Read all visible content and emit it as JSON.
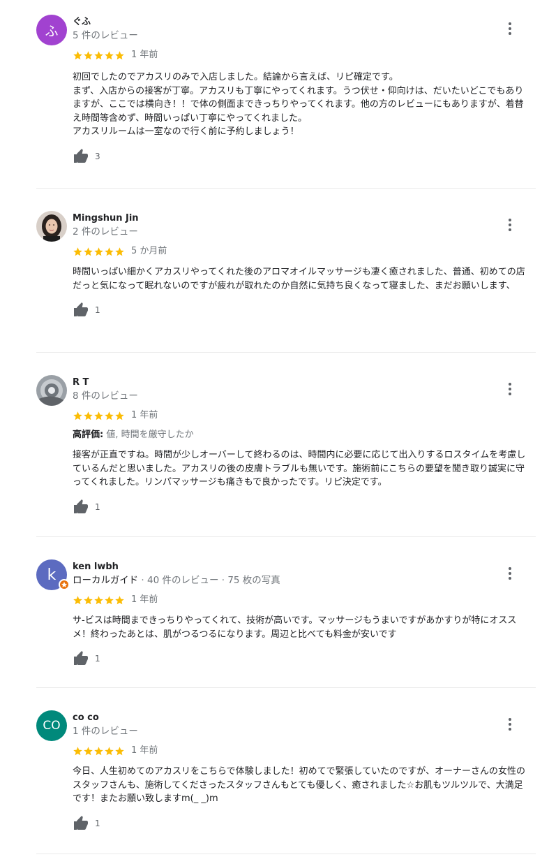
{
  "colors": {
    "star": "#fbbc04",
    "meta_text": "#70757a",
    "icon": "#5f6368",
    "divider": "#ebebeb"
  },
  "reviews": [
    {
      "name": "ぐふ",
      "avatar": {
        "type": "letter",
        "letter": "ふ",
        "bg": "#a142d0"
      },
      "meta": "5 件のレビュー",
      "stars": 5,
      "when": "1 年前",
      "text": "初回でしたのでアカスリのみで入店しました。結論から言えば、リピ確定です。\nまず、入店からの接客が丁寧。アカスリも丁寧にやってくれます。うつ伏せ・仰向けは、だいたいどこでもありますが、ここでは横向き！！で体の側面まできっちりやってくれます。他の方のレビューにもありますが、着替え時間等含めず、時間いっぱい丁寧にやってくれました。\nアカスリルームは一室なので行く前に予約しましょう！",
      "likes": "3",
      "icons": {
        "thumb": "thumbs-up-icon",
        "more": "more-vert-icon"
      }
    },
    {
      "name": "Mingshun Jin",
      "avatar": {
        "type": "photo",
        "description": "profile-photo"
      },
      "meta": "2 件のレビュー",
      "stars": 5,
      "when": "5 か月前",
      "text": "時間いっぱい細かくアカスリやってくれた後のアロマオイルマッサージも凄く癒されました、普通、初めての店だっと気になって眠れないのですが疲れが取れたのか自然に気持ち良くなって寝ました、まだお願いします、",
      "likes": "1",
      "icons": {
        "thumb": "thumbs-up-icon",
        "more": "more-vert-icon"
      }
    },
    {
      "name": "R T",
      "avatar": {
        "type": "photo",
        "description": "profile-photo"
      },
      "meta": "8 件のレビュー",
      "stars": 5,
      "when": "1 年前",
      "highlight_label": "高評価:",
      "highlight_value": " 値, 時間を厳守したか",
      "text": "接客が正直ですね。時間が少しオーバーして終わるのは、時間内に必要に応じて出入りするロスタイムを考慮しているんだと思いました。アカスリの後の皮膚トラブルも無いです。施術前にこちらの要望を聞き取り誠実に守ってくれました。リンパマッサージも痛きもで良かったです。リピ決定です。",
      "likes": "1",
      "icons": {
        "thumb": "thumbs-up-icon",
        "more": "more-vert-icon"
      }
    },
    {
      "name": "ken lwbh",
      "avatar": {
        "type": "letter",
        "letter": "k",
        "bg": "#5c6bc0",
        "local_guide": true
      },
      "meta_guide": "ローカルガイド",
      "meta": " · 40 件のレビュー · 75 枚の写真",
      "stars": 5,
      "when": "1 年前",
      "text": "サ-ビスは時間まできっちりやってくれて、技術が高いです。マッサージもうまいですがあかすりが特にオススメ！終わったあとは、肌がつるつるになります。周辺と比べても料金が安いです",
      "likes": "1",
      "icons": {
        "thumb": "thumbs-up-icon",
        "more": "more-vert-icon"
      }
    },
    {
      "name": "co co",
      "avatar": {
        "type": "letter",
        "letter": "CO",
        "bg": "#00897b"
      },
      "meta": "1 件のレビュー",
      "stars": 5,
      "when": "1 年前",
      "text": "今日、人生初めてのアカスリをこちらで体験しました！初めてで緊張していたのですが、オーナーさんの女性のスタッフさんも、施術してくださったスタッフさんもとても優しく、癒されました☆お肌もツルツルで、大満足です！またお願い致しますm(_ _)m",
      "likes": "1",
      "icons": {
        "thumb": "thumbs-up-icon",
        "more": "more-vert-icon"
      }
    }
  ]
}
